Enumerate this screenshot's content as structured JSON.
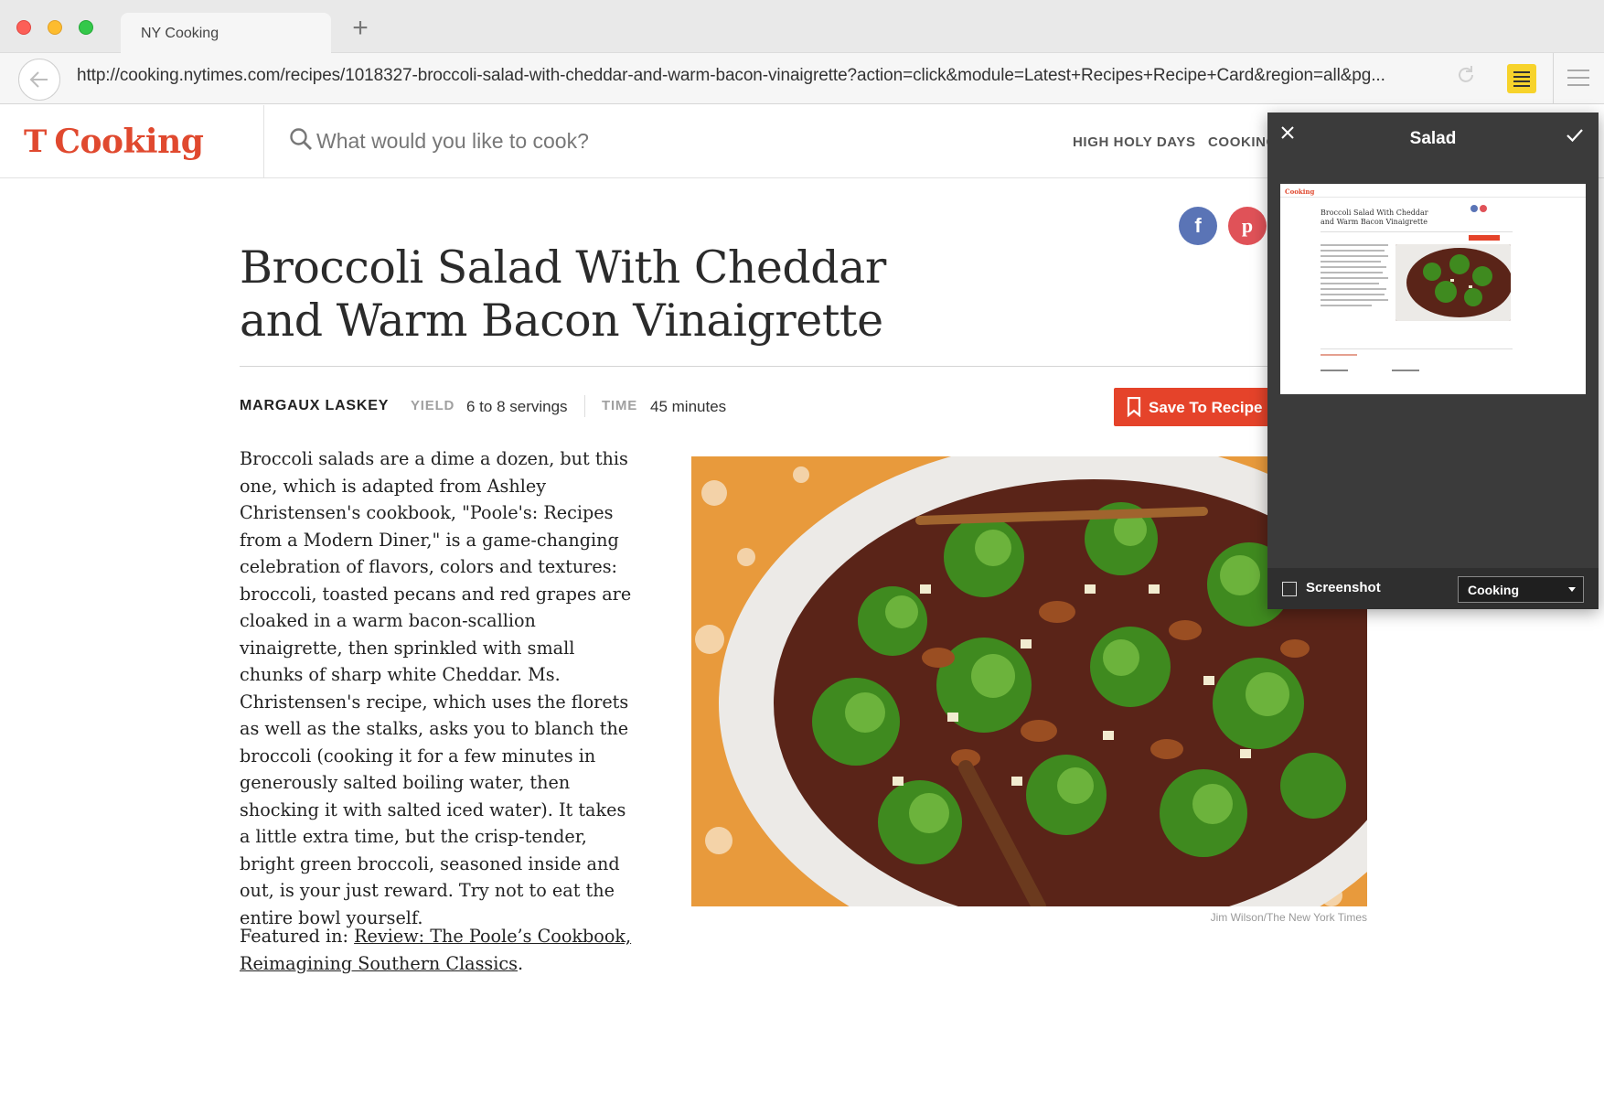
{
  "browser": {
    "tab_title": "NY Cooking",
    "new_tab_symbol": "+",
    "url": "http://cooking.nytimes.com/recipes/1018327-broccoli-salad-with-cheddar-and-warm-bacon-vinaigrette?action=click&module=Latest+Recipes+Recipe+Card&region=all&pg...",
    "back_icon": "arrow-left-icon",
    "reload_icon": "reload-icon",
    "extension_icon": "note-icon",
    "menu_icon": "hamburger-icon"
  },
  "site": {
    "logo_mark": "T",
    "logo_text": "Cooking",
    "search_placeholder": "What would you like to cook?",
    "nav": [
      "HIGH HOLY DAYS",
      "COOKING"
    ],
    "brand_color": "#e0492f"
  },
  "recipe": {
    "title": "Broccoli Salad With Cheddar and Warm Bacon Vinaigrette",
    "author": "MARGAUX LASKEY",
    "yield_label": "YIELD",
    "yield_value": "6 to 8 servings",
    "time_label": "TIME",
    "time_value": "45 minutes",
    "save_button": "Save To Recipe Box",
    "description": "Broccoli salads are a dime a dozen, but this one, which is adapted from Ashley Christensen's cookbook, \"Poole's: Recipes from a Modern Diner,\" is a game-changing celebration of flavors, colors and textures: broccoli, toasted pecans and red grapes are cloaked in a warm bacon-scallion vinaigrette, then sprinkled with small chunks of sharp white Cheddar. Ms. Christensen's recipe, which uses the florets as well as the stalks, asks you to blanch the broccoli (cooking it for a few minutes in generously salted boiling water, then shocking it with salted iced water). It takes a little extra time, but the crisp-tender, bright green broccoli, seasoned inside and out, is your just reward. Try not to eat the entire bowl yourself.",
    "featured_prefix": "Featured in: ",
    "featured_link": "Review: The Poole’s Cookbook, Reimagining Southern Classics",
    "featured_suffix": ".",
    "photo_credit": "Jim Wilson/The New York Times",
    "share_icons": [
      "facebook-icon",
      "pinterest-icon"
    ]
  },
  "clipper": {
    "title": "Salad",
    "close_icon": "close-icon",
    "confirm_icon": "checkmark-icon",
    "mode_label": "Screenshot",
    "notebook": "Cooking",
    "thumbnail": {
      "logo": "Cooking",
      "title": "Broccoli Salad With Cheddar and Warm Bacon Vinaigrette"
    }
  }
}
